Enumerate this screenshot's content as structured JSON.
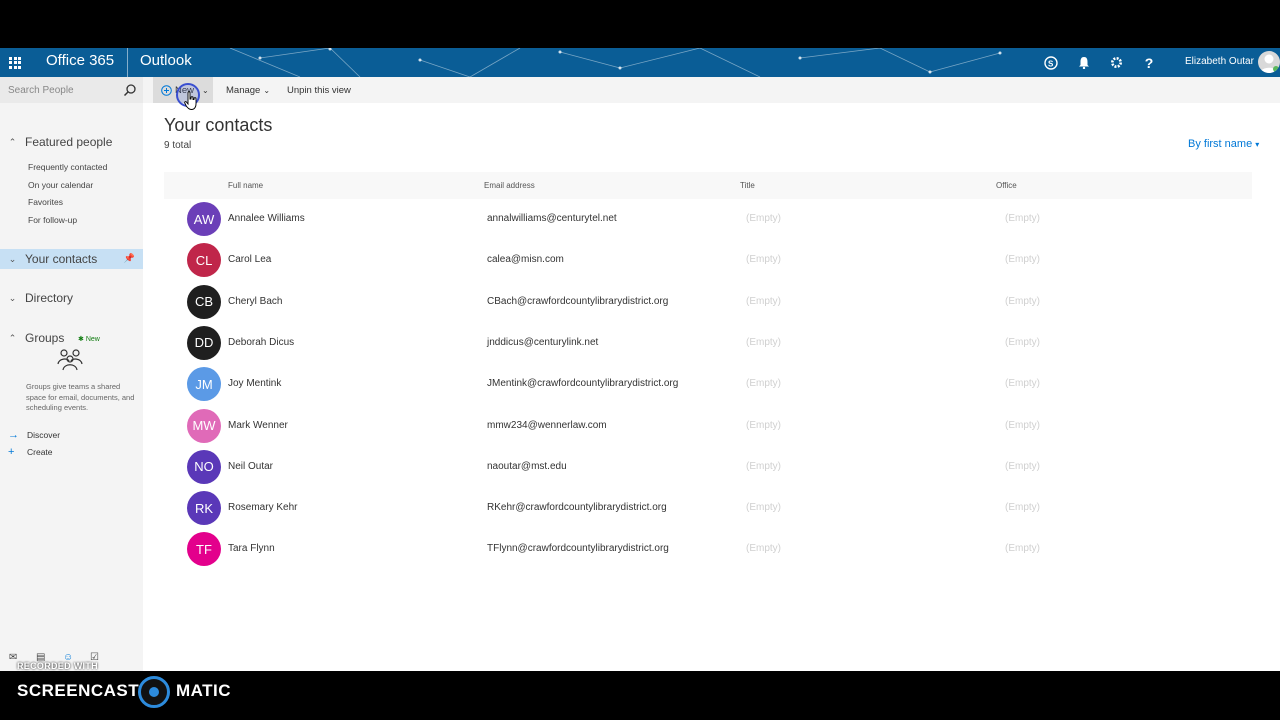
{
  "suite": {
    "brand": "Office 365",
    "app": "Outlook",
    "user_name": "Elizabeth Outar",
    "icons": [
      "skype-icon",
      "bell-icon",
      "gear-icon",
      "help-icon"
    ]
  },
  "left": {
    "search_placeholder": "Search People",
    "featured_title": "Featured people",
    "featured_items": [
      "Frequently contacted",
      "On your calendar",
      "Favorites",
      "For follow-up"
    ],
    "your_contacts": "Your contacts",
    "directory": "Directory",
    "groups": "Groups",
    "new_badge": "New",
    "groups_desc": "Groups give teams a shared space for email, documents, and scheduling events.",
    "discover": "Discover",
    "create": "Create"
  },
  "cmdbar": {
    "new_label": "New",
    "manage_label": "Manage",
    "unpin_label": "Unpin this view"
  },
  "main": {
    "title": "Your contacts",
    "total": "9 total",
    "sort_label": "By first name",
    "columns": [
      "Full name",
      "Email address",
      "Title",
      "Office"
    ],
    "contacts": [
      {
        "initials": "AW",
        "name": "Annalee Williams",
        "email": "annalwilliams@centurytel.net",
        "title": "(Empty)",
        "office": "(Empty)",
        "color": "#6b3fb8"
      },
      {
        "initials": "CL",
        "name": "Carol Lea",
        "email": "calea@misn.com",
        "title": "(Empty)",
        "office": "(Empty)",
        "color": "#c0264a"
      },
      {
        "initials": "CB",
        "name": "Cheryl Bach",
        "email": "CBach@crawfordcountylibrarydistrict.org",
        "title": "(Empty)",
        "office": "(Empty)",
        "color": "#1f1f1f"
      },
      {
        "initials": "DD",
        "name": "Deborah Dicus",
        "email": "jnddicus@centurylink.net",
        "title": "(Empty)",
        "office": "(Empty)",
        "color": "#1f1f1f"
      },
      {
        "initials": "JM",
        "name": "Joy Mentink",
        "email": "JMentink@crawfordcountylibrarydistrict.org",
        "title": "(Empty)",
        "office": "(Empty)",
        "color": "#5b9ae6"
      },
      {
        "initials": "MW",
        "name": "Mark Wenner",
        "email": "mmw234@wennerlaw.com",
        "title": "(Empty)",
        "office": "(Empty)",
        "color": "#e06ab8"
      },
      {
        "initials": "NO",
        "name": "Neil Outar",
        "email": "naoutar@mst.edu",
        "title": "(Empty)",
        "office": "(Empty)",
        "color": "#5a38b8"
      },
      {
        "initials": "RK",
        "name": "Rosemary Kehr",
        "email": "RKehr@crawfordcountylibrarydistrict.org",
        "title": "(Empty)",
        "office": "(Empty)",
        "color": "#5a38b8"
      },
      {
        "initials": "TF",
        "name": "Tara Flynn",
        "email": "TFlynn@crawfordcountylibrarydistrict.org",
        "title": "(Empty)",
        "office": "(Empty)",
        "color": "#e3008c"
      }
    ]
  },
  "watermark": {
    "recorded": "RECORDED WITH",
    "brand_left": "SCREENCAST",
    "brand_right": "MATIC"
  }
}
